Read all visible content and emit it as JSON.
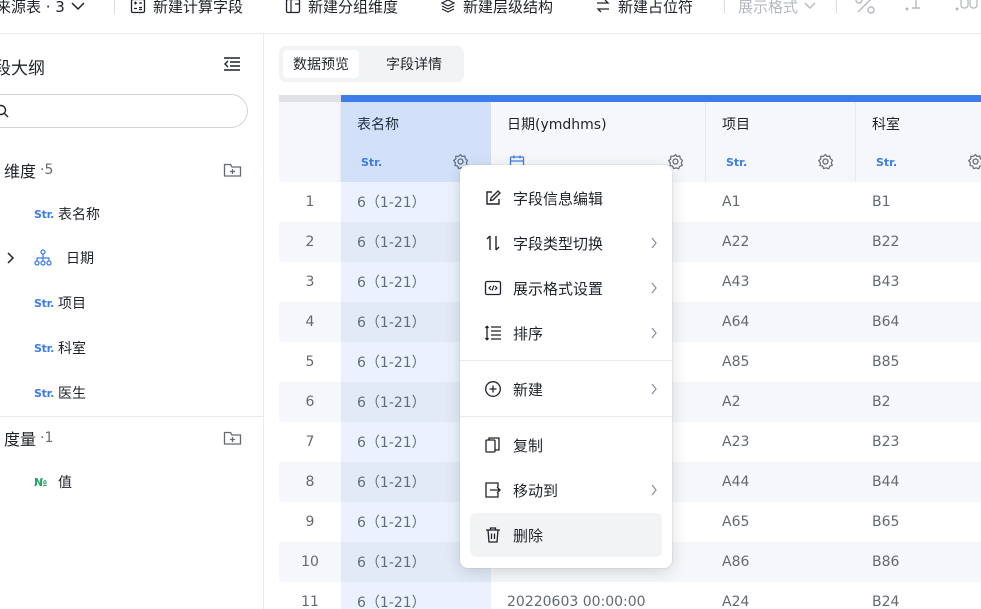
{
  "toolbar": {
    "source_label": "来源表 · 3",
    "new_calc_field": "新建计算字段",
    "new_group_dim": "新建分组维度",
    "new_hierarchy": "新建层级结构",
    "new_placeholder": "新建占位符",
    "display_format": "展示格式"
  },
  "outline": {
    "title": "段大纲",
    "dimension_label": "维度",
    "dimension_count": "·5",
    "measure_label": "度量",
    "measure_count": "·1",
    "dimensions": [
      {
        "type": "Str.",
        "name": "表名称"
      },
      {
        "type": "hier",
        "name": "日期"
      },
      {
        "type": "Str.",
        "name": "项目"
      },
      {
        "type": "Str.",
        "name": "科室"
      },
      {
        "type": "Str.",
        "name": "医生"
      }
    ],
    "measures": [
      {
        "type": "№",
        "name": "值"
      }
    ]
  },
  "tabs": [
    {
      "label": "数据预览",
      "active": true
    },
    {
      "label": "字段详情",
      "active": false
    }
  ],
  "table": {
    "columns": [
      {
        "name": "表名称",
        "type": "Str."
      },
      {
        "name": "日期(ymdhms)",
        "type": ""
      },
      {
        "name": "项目",
        "type": "Str."
      },
      {
        "name": "科室",
        "type": "Str."
      }
    ],
    "rows": [
      {
        "idx": "1",
        "c1": "6（1-21）",
        "c2": "",
        "c3": "A1",
        "c4": "B1"
      },
      {
        "idx": "2",
        "c1": "6（1-21）",
        "c2": "",
        "c3": "A22",
        "c4": "B22"
      },
      {
        "idx": "3",
        "c1": "6（1-21）",
        "c2": "",
        "c3": "A43",
        "c4": "B43"
      },
      {
        "idx": "4",
        "c1": "6（1-21）",
        "c2": "",
        "c3": "A64",
        "c4": "B64"
      },
      {
        "idx": "5",
        "c1": "6（1-21）",
        "c2": "",
        "c3": "A85",
        "c4": "B85"
      },
      {
        "idx": "6",
        "c1": "6（1-21）",
        "c2": "",
        "c3": "A2",
        "c4": "B2"
      },
      {
        "idx": "7",
        "c1": "6（1-21）",
        "c2": "",
        "c3": "A23",
        "c4": "B23"
      },
      {
        "idx": "8",
        "c1": "6（1-21）",
        "c2": "",
        "c3": "A44",
        "c4": "B44"
      },
      {
        "idx": "9",
        "c1": "6（1-21）",
        "c2": "",
        "c3": "A65",
        "c4": "B65"
      },
      {
        "idx": "10",
        "c1": "6（1-21）",
        "c2": "",
        "c3": "A86",
        "c4": "B86"
      },
      {
        "idx": "11",
        "c1": "6（1-21）",
        "c2": "20220603 00:00:00",
        "c3": "A24",
        "c4": "B24"
      }
    ]
  },
  "context_menu": {
    "items": [
      {
        "label": "字段信息编辑",
        "icon": "edit-icon",
        "submenu": false
      },
      {
        "label": "字段类型切换",
        "icon": "swap-vertical-icon",
        "submenu": true
      },
      {
        "label": "展示格式设置",
        "icon": "code-icon",
        "submenu": true
      },
      {
        "label": "排序",
        "icon": "sort-icon",
        "submenu": true
      },
      {
        "label": "新建",
        "icon": "plus-circle-icon",
        "submenu": true
      },
      {
        "label": "复制",
        "icon": "copy-icon",
        "submenu": false
      },
      {
        "label": "移动到",
        "icon": "move-to-icon",
        "submenu": true
      },
      {
        "label": "删除",
        "icon": "trash-icon",
        "submenu": false
      }
    ]
  },
  "colors": {
    "accent": "#3b7de9",
    "number_tag": "#1fa660"
  }
}
